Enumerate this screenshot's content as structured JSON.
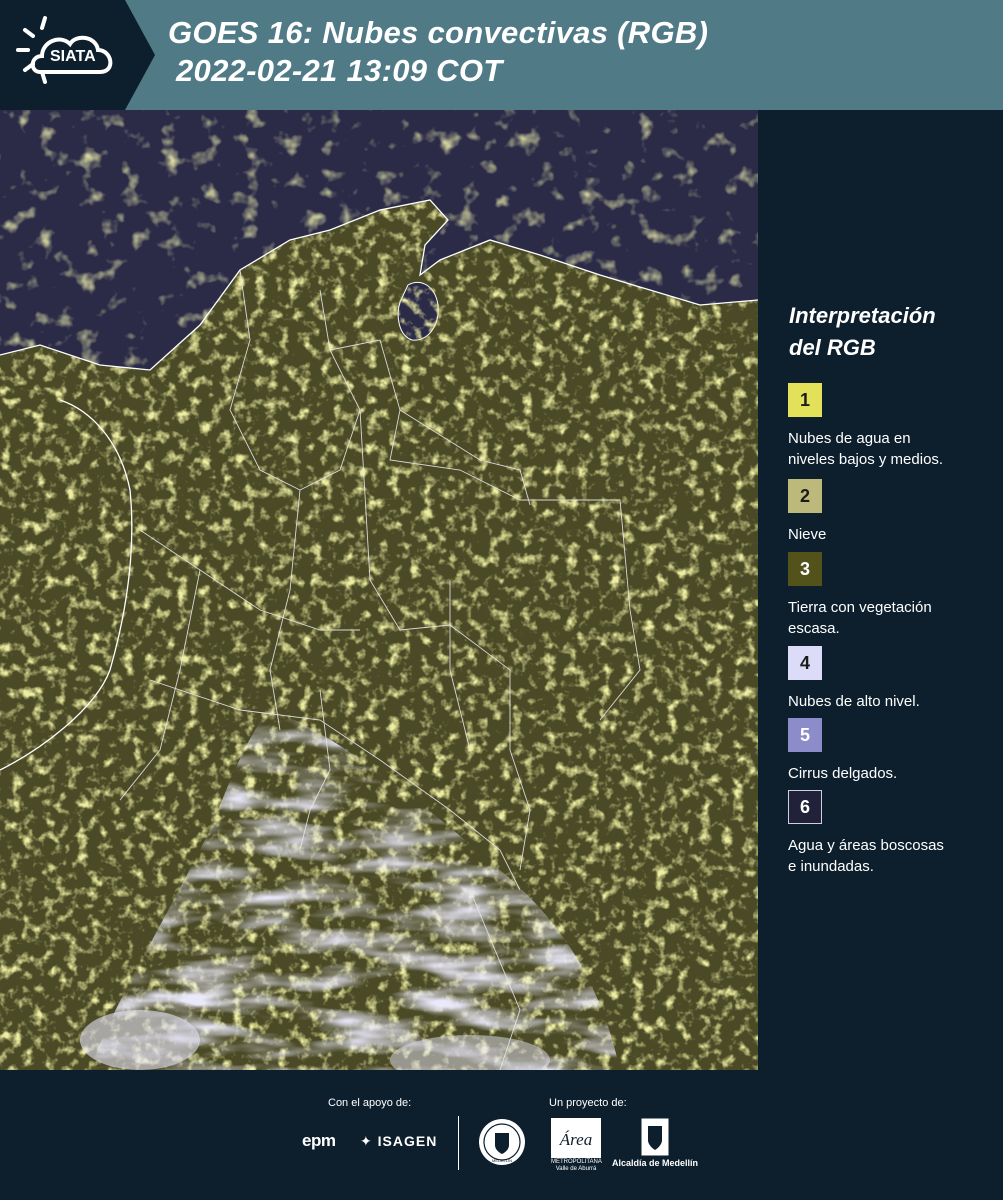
{
  "header": {
    "logo_text": "SIATA",
    "title_line1": "GOES 16: Nubes convectivas (RGB)",
    "title_line2": "2022-02-21 13:09 COT",
    "background_color": "#4f7a86"
  },
  "legend": {
    "title_line1": "Interpretación",
    "title_line2": "del RGB",
    "items": [
      {
        "number": "1",
        "label_line1": "Nubes de agua en",
        "label_line2": "niveles bajos y medios.",
        "color": "#e3e15a"
      },
      {
        "number": "2",
        "label_line1": "Nieve",
        "label_line2": "",
        "color": "#bcb97a"
      },
      {
        "number": "3",
        "label_line1": "Tierra con vegetación",
        "label_line2": "escasa.",
        "color": "#54521b"
      },
      {
        "number": "4",
        "label_line1": "Nubes de alto nivel.",
        "label_line2": "",
        "color": "#dcdcf8"
      },
      {
        "number": "5",
        "label_line1": "Cirrus delgados.",
        "label_line2": "",
        "color": "#8c8cca"
      },
      {
        "number": "6",
        "label_line1": "Agua y áreas boscosas",
        "label_line2": "e inundadas.",
        "color": "#22213a"
      }
    ]
  },
  "footer": {
    "support_label": "Con el apoyo de:",
    "project_label": "Un proyecto de:",
    "logos": {
      "epm": "epm",
      "isagen": "ISAGEN",
      "seal": "MEDELLÍN",
      "area": "Área",
      "area_sub": "METROPOLITANA Valle de Aburrá",
      "alcaldia": "Alcaldía de Medellín"
    }
  },
  "colors": {
    "background_dark": "#0d1f2d",
    "ocean": "#2b2b48",
    "land": "#4a4a26",
    "cloud_yellow": "#d8d85c",
    "cloud_high": "#cfcdef",
    "borders": "#ffffff"
  }
}
